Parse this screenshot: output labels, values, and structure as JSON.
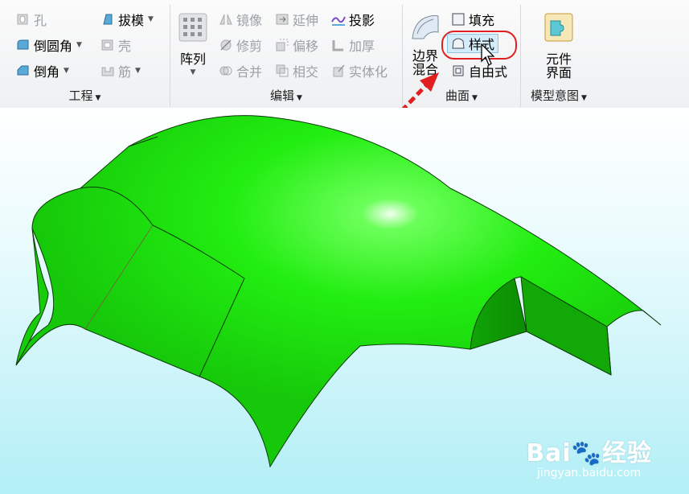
{
  "ribbon": {
    "engineering": {
      "label": "工程",
      "hole": "孔",
      "round": "倒圆角",
      "chamfer": "倒角",
      "draft": "拔模",
      "shell": "壳",
      "rib": "筋"
    },
    "editing": {
      "label": "编辑",
      "pattern": "阵列",
      "mirror": "镜像",
      "trim": "修剪",
      "merge": "合并",
      "extend": "延伸",
      "offset": "偏移",
      "intersect": "相交",
      "project": "投影",
      "thicken": "加厚",
      "solidify": "实体化"
    },
    "surfaces": {
      "label": "曲面",
      "boundary_blend_1": "边界",
      "boundary_blend_2": "混合",
      "fill": "填充",
      "style": "样式",
      "freestyle": "自由式"
    },
    "model_intent": {
      "label": "模型意图",
      "component_interface_1": "元件",
      "component_interface_2": "界面"
    }
  },
  "watermark": {
    "logo_left": "Bai",
    "logo_right": "经验",
    "url": "jingyan.baidu.com"
  },
  "colors": {
    "model_green": "#22ee11",
    "highlight_red": "#e02020",
    "ribbon_bg": "#f4f5f6",
    "viewport_bottom": "#b2eff6"
  }
}
